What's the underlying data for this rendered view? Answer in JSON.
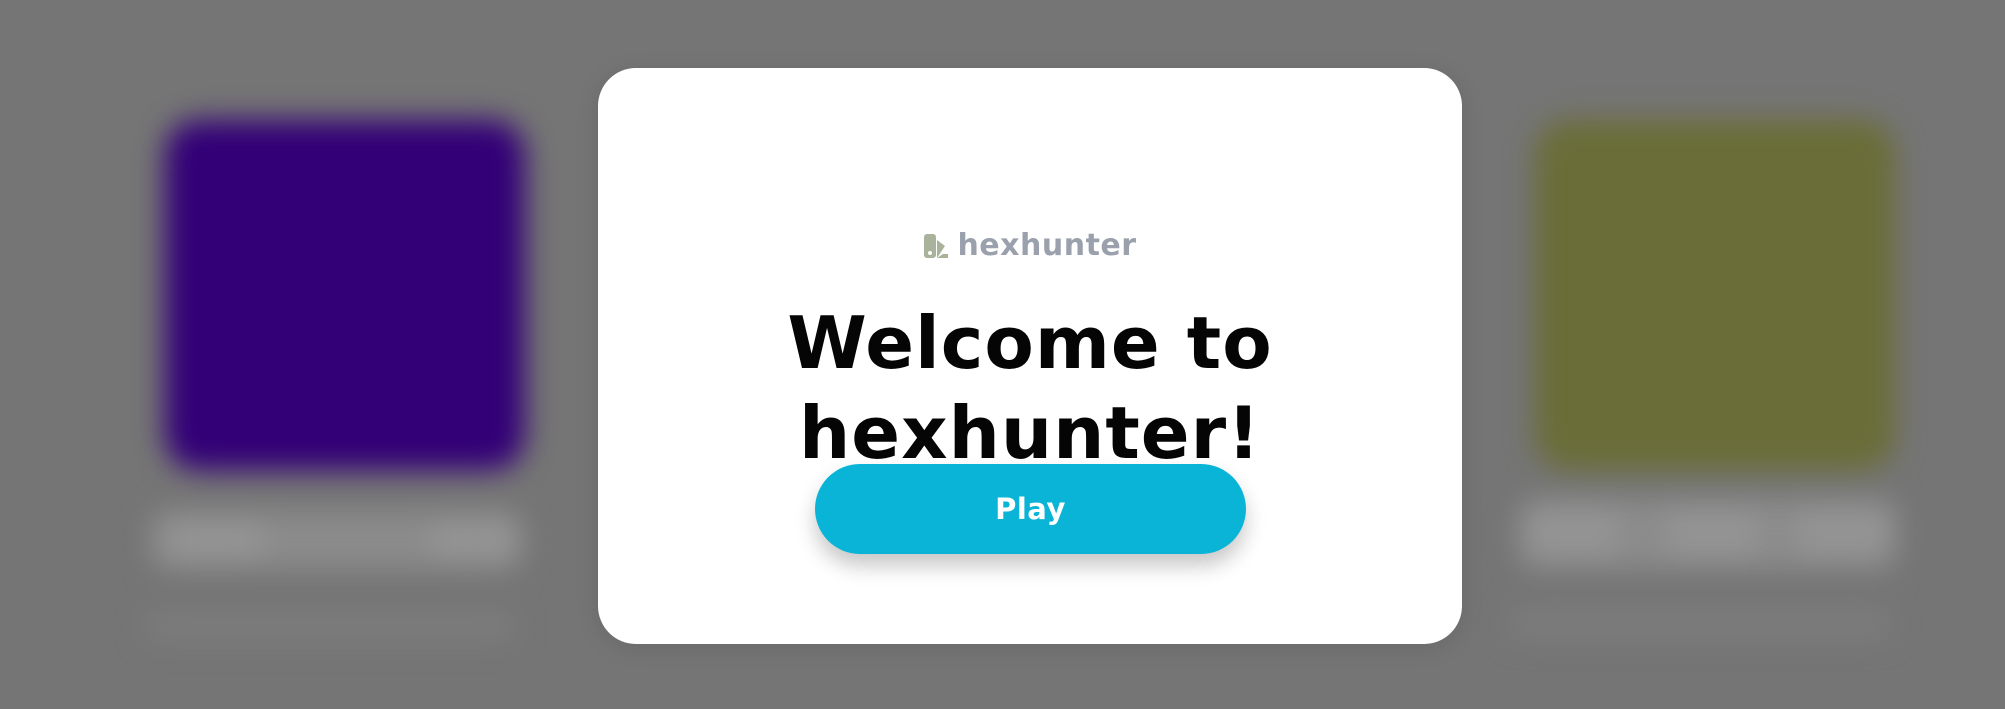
{
  "app": {
    "brand_name": "hexhunter",
    "brand_icon": "paint-swatch-icon",
    "brand_color": "#9aa1ad"
  },
  "welcome_modal": {
    "title_line1": "Welcome to",
    "title_line2": "hexhunter!",
    "play_label": "Play",
    "play_button_color": "#09b4d6"
  },
  "background": {
    "overlay_color": "#757575",
    "left_swatch_color": "#330077",
    "right_swatch_color": "#6a6d37"
  }
}
